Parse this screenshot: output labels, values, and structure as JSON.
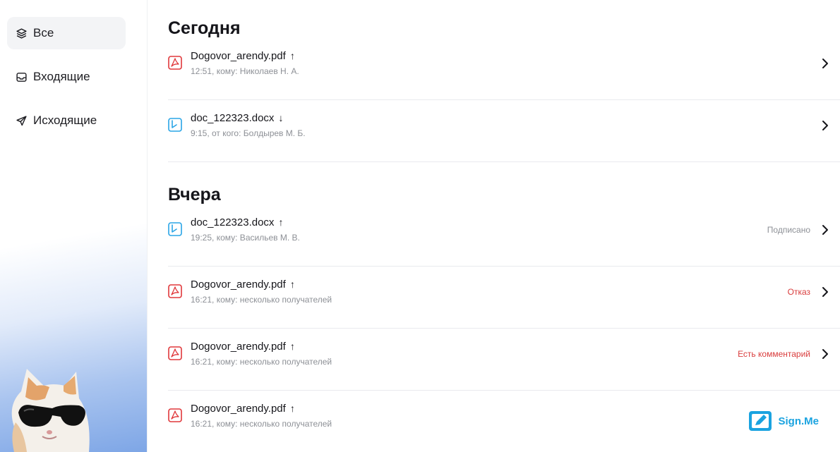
{
  "sidebar": {
    "items": [
      {
        "label": "Все",
        "icon": "layers-icon",
        "active": true
      },
      {
        "label": "Входящие",
        "icon": "inbox-icon",
        "active": false
      },
      {
        "label": "Исходящие",
        "icon": "send-icon",
        "active": false
      }
    ]
  },
  "sections": [
    {
      "title": "Сегодня",
      "rows": [
        {
          "file": "Dogovor_arendy.pdf",
          "type": "pdf",
          "direction": "↑",
          "meta": "12:51, кому: Николаев Н. А.",
          "status": ""
        },
        {
          "file": "doc_122323.docx",
          "type": "docx",
          "direction": "↓",
          "meta": "9:15, от кого: Болдырев М. Б.",
          "status": ""
        }
      ]
    },
    {
      "title": "Вчера",
      "rows": [
        {
          "file": "doc_122323.docx",
          "type": "docx",
          "direction": "↑",
          "meta": "19:25, кому: Васильев М. В.",
          "status": "Подписано"
        },
        {
          "file": "Dogovor_arendy.pdf",
          "type": "pdf",
          "direction": "↑",
          "meta": "16:21, кому: несколько получателей",
          "status": "Отказ"
        },
        {
          "file": "Dogovor_arendy.pdf",
          "type": "pdf",
          "direction": "↑",
          "meta": "16:21, кому: несколько получателей",
          "status": "Есть комментарий"
        },
        {
          "file": "Dogovor_arendy.pdf",
          "type": "pdf",
          "direction": "↑",
          "meta": "16:21, кому: несколько получателей",
          "status": ""
        }
      ]
    }
  ],
  "brand": {
    "name": "Sign.Me",
    "color": "#1aa3e0"
  },
  "colors": {
    "pdf": "#e0383b",
    "docx": "#2aa5e6",
    "danger": "#d93c3c",
    "muted": "#8d9096"
  }
}
